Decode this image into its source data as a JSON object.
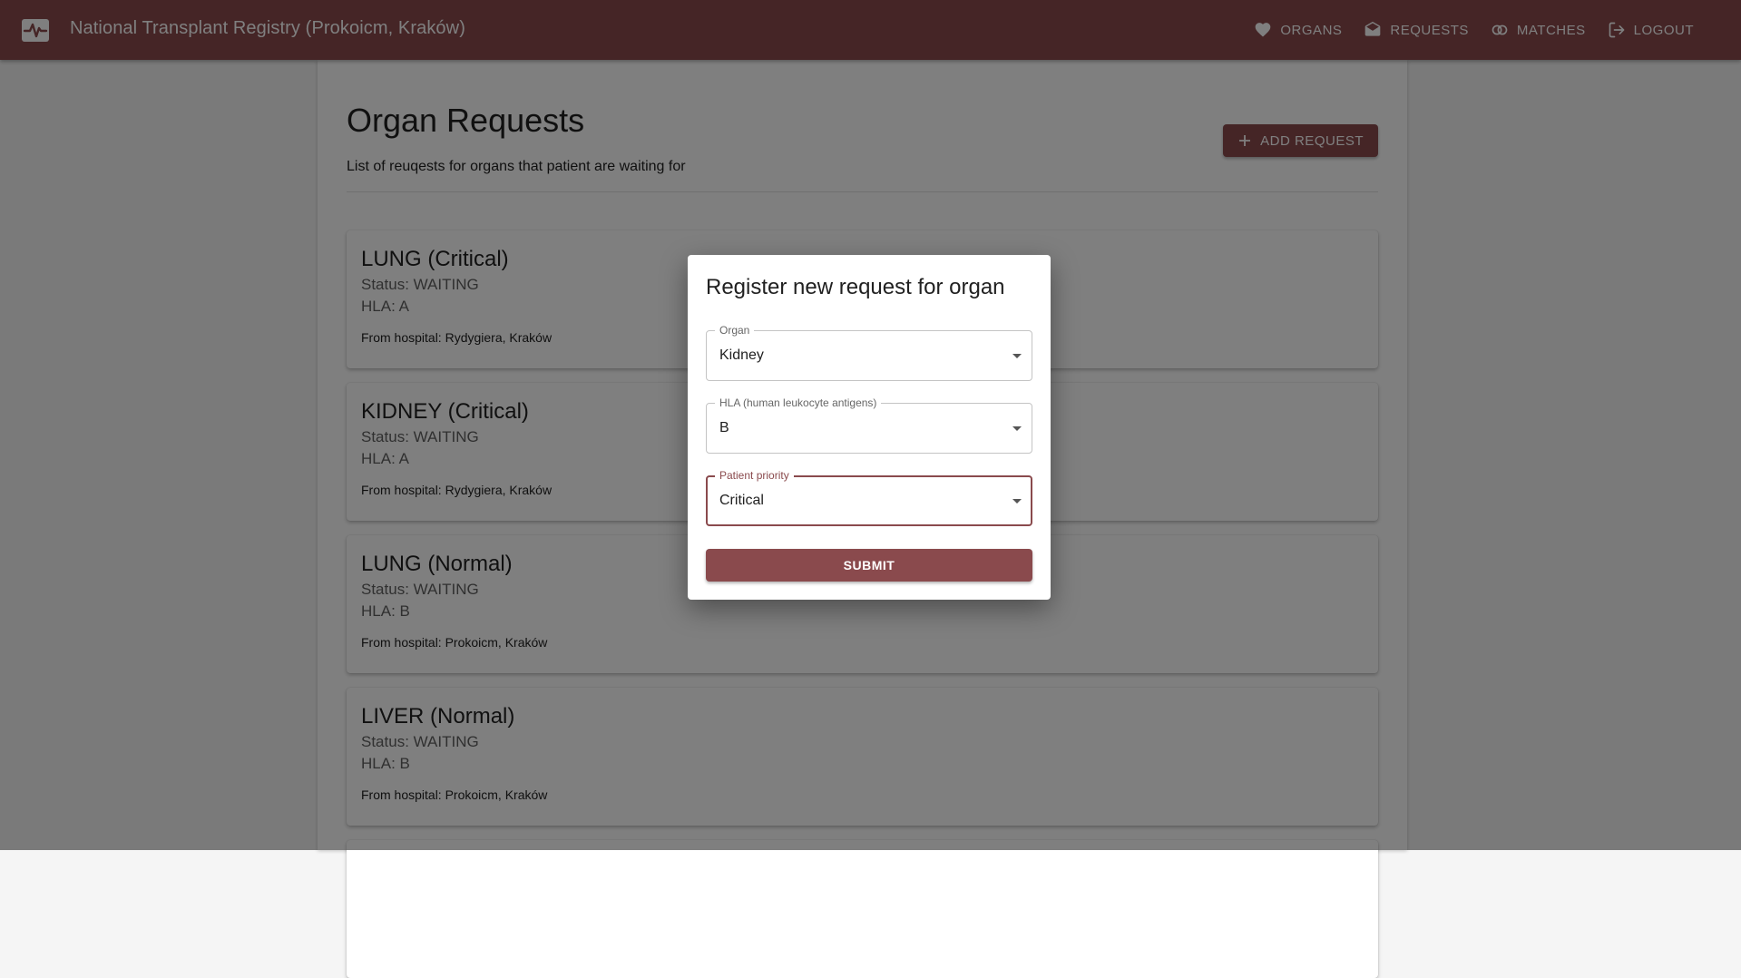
{
  "header": {
    "title": "National Transplant Registry (Prokoicm, Kraków)",
    "logo_icon": "heartbeat-monitor-icon",
    "nav": [
      {
        "label": "ORGANS",
        "icon": "heart-icon"
      },
      {
        "label": "REQUESTS",
        "icon": "envelope-open-icon"
      },
      {
        "label": "MATCHES",
        "icon": "rings-icon"
      },
      {
        "label": "LOGOUT",
        "icon": "logout-icon"
      }
    ]
  },
  "page": {
    "title": "Organ Requests",
    "subtitle": "List of reuqests for organs that patient are waiting for",
    "add_button_label": "ADD REQUEST"
  },
  "requests": [
    {
      "title": "LUNG (Critical)",
      "status": "Status: WAITING",
      "hla": "HLA: A",
      "hospital": "From hospital: Rydygiera, Kraków"
    },
    {
      "title": "KIDNEY (Critical)",
      "status": "Status: WAITING",
      "hla": "HLA: A",
      "hospital": "From hospital: Rydygiera, Kraków"
    },
    {
      "title": "LUNG (Normal)",
      "status": "Status: WAITING",
      "hla": "HLA: B",
      "hospital": "From hospital: Prokoicm, Kraków"
    },
    {
      "title": "LIVER (Normal)",
      "status": "Status: WAITING",
      "hla": "HLA: B",
      "hospital": "From hospital: Prokoicm, Kraków"
    }
  ],
  "dialog": {
    "title": "Register new request for organ",
    "fields": [
      {
        "label": "Organ",
        "value": "Kidney"
      },
      {
        "label": "HLA (human leukocyte antigens)",
        "value": "B"
      },
      {
        "label": "Patient priority",
        "value": "Critical"
      }
    ],
    "submit_label": "SUBMIT"
  },
  "colors": {
    "primary": "#8a4a4d",
    "overlay": "rgba(0,0,0,0.5)"
  }
}
